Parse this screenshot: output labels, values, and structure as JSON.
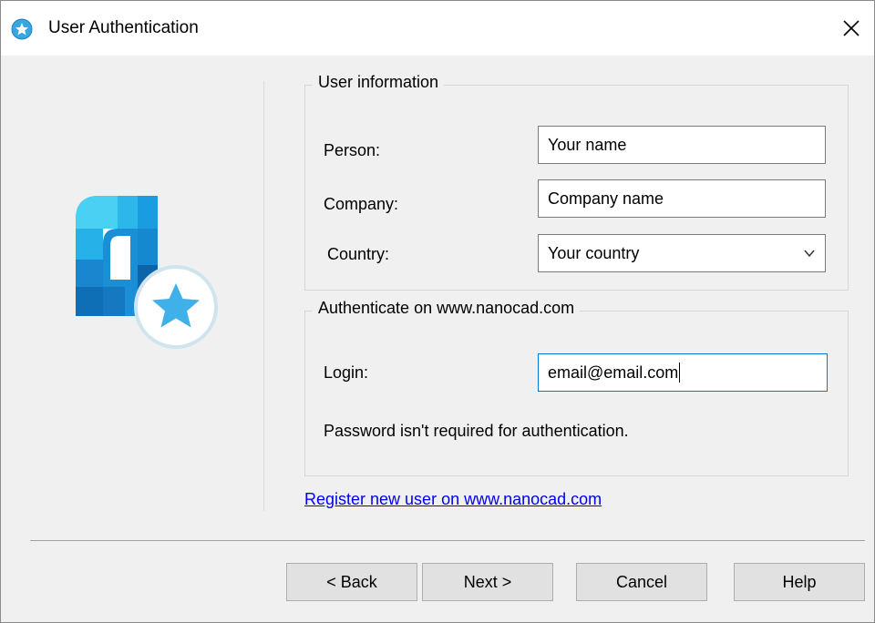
{
  "window": {
    "title": "User Authentication"
  },
  "user_info": {
    "legend": "User information",
    "person_label": "Person:",
    "person_value": "Your name",
    "company_label": "Company:",
    "company_value": "Company name",
    "country_label": "Country:",
    "country_value": "Your country"
  },
  "auth": {
    "legend": "Authenticate on www.nanocad.com",
    "login_label": "Login:",
    "login_value": "email@email.com",
    "note": "Password isn't required for authentication."
  },
  "register_link": "Register new user on www.nanocad.com",
  "buttons": {
    "back": "< Back",
    "next": "Next >",
    "cancel": "Cancel",
    "help": "Help"
  },
  "colors": {
    "accent_blue": "#0078d7",
    "link_blue": "#0000ee",
    "logo_blue": "#1f8fd6",
    "logo_cyan": "#3cc6f0"
  },
  "icons": {
    "title": "star-badge-icon",
    "hero": "nanocad-star-logo-icon",
    "close": "close-icon",
    "dropdown": "chevron-down-icon"
  }
}
